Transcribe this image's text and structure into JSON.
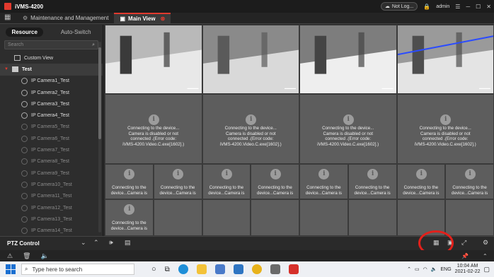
{
  "app": {
    "title": "iVMS-4200",
    "user_status": "Not Log...",
    "user": "admin"
  },
  "tabs": [
    {
      "label": "Maintenance and Management"
    },
    {
      "label": "Main View"
    }
  ],
  "left_panel": {
    "tabs": [
      "Resource",
      "Auto-Switch"
    ],
    "search_placeholder": "Search",
    "custom_view": "Custom View",
    "group": "Test",
    "cameras": [
      {
        "label": "IP Camera1_Test",
        "online": true
      },
      {
        "label": "IP Camera2_Test",
        "online": true
      },
      {
        "label": "IP Camera3_Test",
        "online": true
      },
      {
        "label": "IP Camera4_Test",
        "online": true
      },
      {
        "label": "IP Camera5_Test",
        "online": false
      },
      {
        "label": "IP Camera6_Test",
        "online": false
      },
      {
        "label": "IP Camera7_Test",
        "online": false
      },
      {
        "label": "IP Camera8_Test",
        "online": false
      },
      {
        "label": "IP Camera9_Test",
        "online": false
      },
      {
        "label": "IP Camera10_Test",
        "online": false
      },
      {
        "label": "IP Camera11_Test",
        "online": false
      },
      {
        "label": "IP Camera12_Test",
        "online": false
      },
      {
        "label": "IP Camera13_Test",
        "online": false
      },
      {
        "label": "IP Camera14_Test",
        "online": false
      }
    ]
  },
  "grid": {
    "error_message_full": [
      "Connecting to the device...",
      "Camera is disabled or not",
      "connected .(Error code:",
      "iVMS-4200.Video.C.exe[1602].)"
    ],
    "error_message_short": [
      "Connecting to the",
      "device...Camera is"
    ]
  },
  "toolbar": {
    "ptz_label": "PTZ Control"
  },
  "taskbar": {
    "search_placeholder": "Type here to search",
    "lang": "ENG",
    "time": "10:04 AM",
    "date": "2021-02-22"
  },
  "colors": {
    "accent": "#e23a2e",
    "highlight_circle": "#e3201b"
  }
}
